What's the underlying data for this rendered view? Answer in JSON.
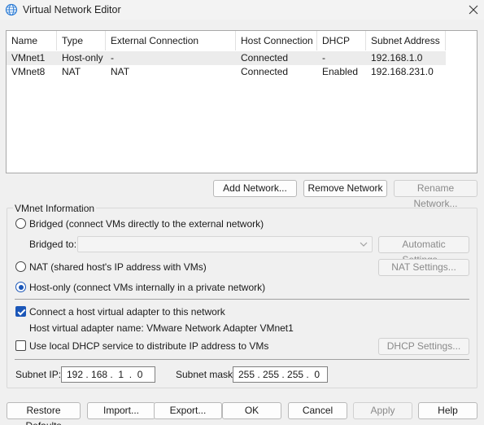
{
  "window": {
    "title": "Virtual Network Editor"
  },
  "table": {
    "columns": [
      "Name",
      "Type",
      "External Connection",
      "Host Connection",
      "DHCP",
      "Subnet Address"
    ],
    "rows": [
      [
        "VMnet1",
        "Host-only",
        "-",
        "Connected",
        "-",
        "192.168.1.0"
      ],
      [
        "VMnet8",
        "NAT",
        "NAT",
        "Connected",
        "Enabled",
        "192.168.231.0"
      ]
    ]
  },
  "buttons": {
    "add_network": "Add Network...",
    "remove_network": "Remove Network",
    "rename_network": "Rename Network...",
    "automatic_settings": "Automatic Settings...",
    "nat_settings": "NAT Settings...",
    "dhcp_settings": "DHCP Settings...",
    "restore_defaults": "Restore Defaults",
    "import": "Import...",
    "export": "Export...",
    "ok": "OK",
    "cancel": "Cancel",
    "apply": "Apply",
    "help": "Help"
  },
  "vmnet_info": {
    "legend": "VMnet Information",
    "bridged_label": "Bridged (connect VMs directly to the external network)",
    "bridged_to_label": "Bridged to:",
    "bridged_to_value": "",
    "nat_label": "NAT (shared host's IP address with VMs)",
    "hostonly_label": "Host-only (connect VMs internally in a private network)",
    "selected_mode": "Host-only",
    "connect_adapter_label": "Connect a host virtual adapter to this network",
    "connect_adapter_checked": true,
    "adapter_name_label": "Host virtual adapter name: VMware Network Adapter VMnet1",
    "dhcp_label": "Use local DHCP service to distribute IP address to VMs",
    "dhcp_checked": false,
    "subnet_ip_label": "Subnet IP:",
    "subnet_ip_value": "192 . 168 .  1  .  0",
    "subnet_mask_label": "Subnet mask:",
    "subnet_mask_value": "255 . 255 . 255 .  0"
  },
  "colors": {
    "accent": "#1a56b8",
    "background": "#f0f0f0",
    "selection": "#ececec"
  },
  "icons": {
    "title": "globe-network-icon",
    "close": "close-icon",
    "dropdown": "chevron-down-icon"
  }
}
